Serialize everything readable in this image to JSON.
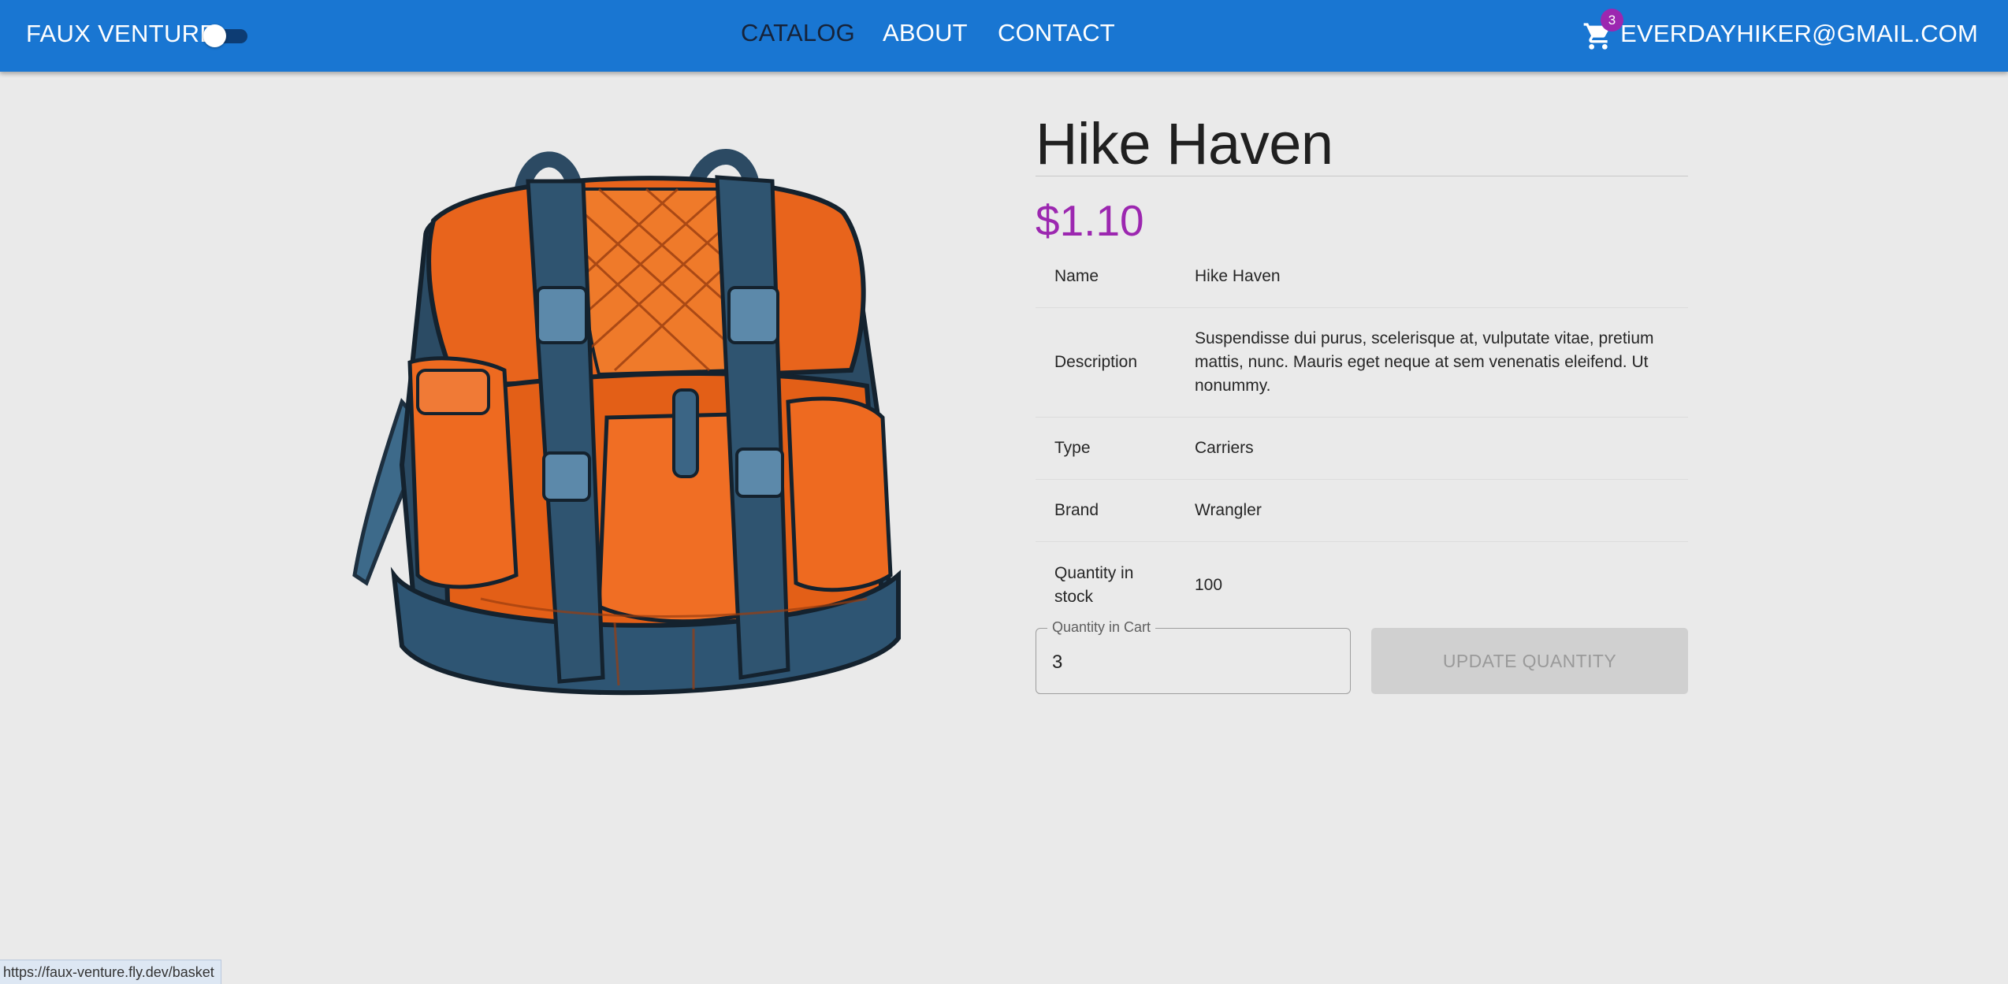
{
  "header": {
    "brand": "FAUX VENTURE",
    "nav": [
      {
        "label": "CATALOG",
        "active": true
      },
      {
        "label": "ABOUT",
        "active": false
      },
      {
        "label": "CONTACT",
        "active": false
      }
    ],
    "cart_count": "3",
    "user_email": "EVERDAYHIKER@GMAIL.COM",
    "theme_toggle_on": false
  },
  "product": {
    "title": "Hike Haven",
    "price": "$1.10",
    "specs": [
      {
        "key": "Name",
        "value": "Hike Haven"
      },
      {
        "key": "Description",
        "value": "Suspendisse dui purus, scelerisque at, vulputate vitae, pretium mattis, nunc. Mauris eget neque at sem venenatis eleifend. Ut nonummy."
      },
      {
        "key": "Type",
        "value": "Carriers"
      },
      {
        "key": "Brand",
        "value": "Wrangler"
      },
      {
        "key": "Quantity in stock",
        "value": "100"
      }
    ],
    "quantity_label": "Quantity in Cart",
    "quantity_value": "3",
    "update_label": "UPDATE QUANTITY"
  },
  "status_bar": {
    "url": "https://faux-venture.fly.dev/basket"
  },
  "colors": {
    "appbar": "#1976d2",
    "price": "#9c27b0",
    "badge": "#9c27b0"
  }
}
